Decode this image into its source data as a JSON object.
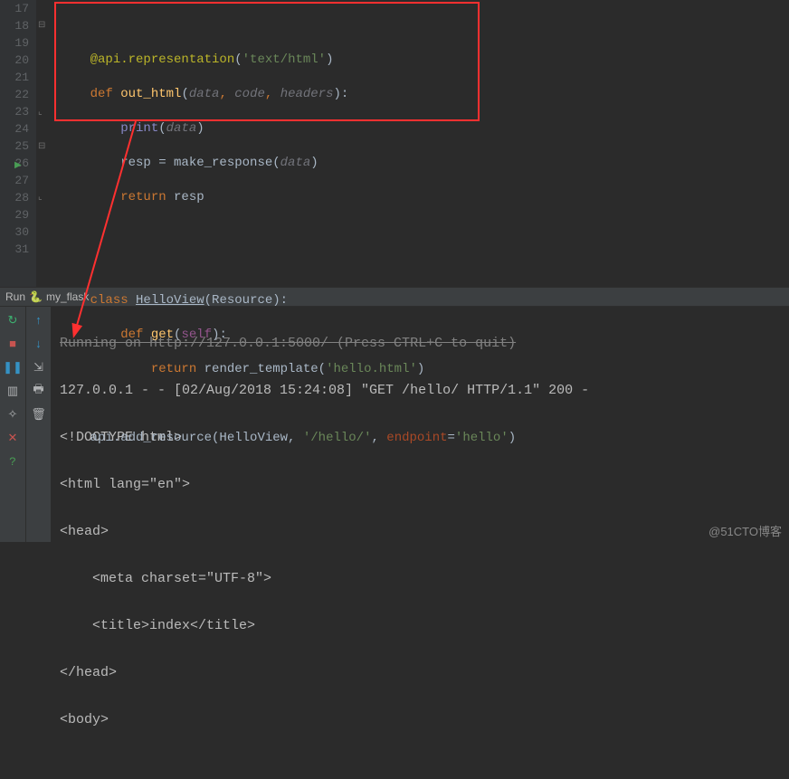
{
  "lines": {
    "17": "17",
    "18": "18",
    "19": "19",
    "20": "20",
    "21": "21",
    "22": "22",
    "23": "23",
    "24": "24",
    "25": "25",
    "26": "26",
    "27": "27",
    "28": "28",
    "29": "29",
    "30": "30",
    "31": "31"
  },
  "code": {
    "l18_dec": "@api.representation",
    "l18_str": "'text/html'",
    "l19_def": "def ",
    "l19_fn": "out_html",
    "l19_p1": "data",
    "l19_p2": "code",
    "l19_p3": "headers",
    "l20_print": "print",
    "l20_arg": "data",
    "l21_var": "resp = make_response(",
    "l21_arg": "data",
    "l22_ret": "return ",
    "l22_val": "resp",
    "l25_class": "class ",
    "l25_name": "HelloView",
    "l25_base": "(Resource):",
    "l26_def": "def ",
    "l26_fn": "get",
    "l26_self": "self",
    "l27_ret": "return ",
    "l27_call": "render_template(",
    "l27_str": "'hello.html'",
    "l29_call": "api.add_resource(HelloView, ",
    "l29_str1": "'/hello/'",
    "l29_named": "endpoint",
    "l29_str2": "'hello'"
  },
  "run": {
    "label": "Run",
    "file": "my_flask"
  },
  "output": {
    "l0": "Running on http://127.0.0.1:5000/ (Press CTRL+C to quit)",
    "l1": "127.0.0.1 - - [02/Aug/2018 15:24:08] \"GET /hello/ HTTP/1.1\" 200 -",
    "l2": "<!DOCTYPE html>",
    "l3": "<html lang=\"en\">",
    "l4": "<head>",
    "l5": "    <meta charset=\"UTF-8\">",
    "l6": "    <title>index</title>",
    "l7": "</head>",
    "l8": "<body>"
  },
  "watermark": "@51CTO博客"
}
